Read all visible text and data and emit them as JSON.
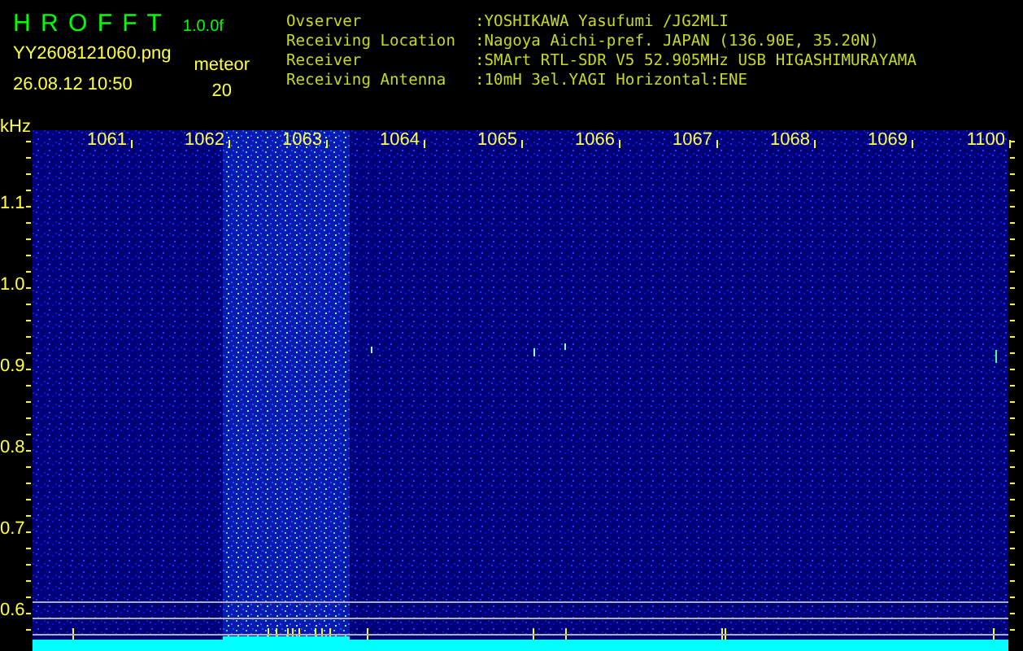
{
  "app": {
    "title": "H R O F F T",
    "version": "1.0.0f"
  },
  "image": {
    "filename": "YY2608121060.png",
    "timestamp": "26.08.12 10:50"
  },
  "detection": {
    "label": "meteor",
    "count": "20"
  },
  "station_info": [
    {
      "label": "Ovserver",
      "value": ":YOSHIKAWA Yasufumi /JG2MLI"
    },
    {
      "label": "Receiving Location",
      "value": ":Nagoya Aichi-pref. JAPAN (136.90E, 35.20N)"
    },
    {
      "label": "Receiver",
      "value": ":SMArt RTL-SDR V5 52.905MHz USB HIGASHIMURAYAMA"
    },
    {
      "label": "Receiving Antenna",
      "value": ":10mH 3el.YAGI Horizontal:ENE"
    }
  ],
  "waterfall": {
    "y_unit": "kHz",
    "x_labels": [
      "1061",
      "1062",
      "1063",
      "1064",
      "1065",
      "1066",
      "1067",
      "1068",
      "1069",
      "1100"
    ],
    "y_labels": [
      "1.1",
      "1.0",
      "0.9",
      "0.8",
      "0.7",
      "0.6"
    ]
  }
}
